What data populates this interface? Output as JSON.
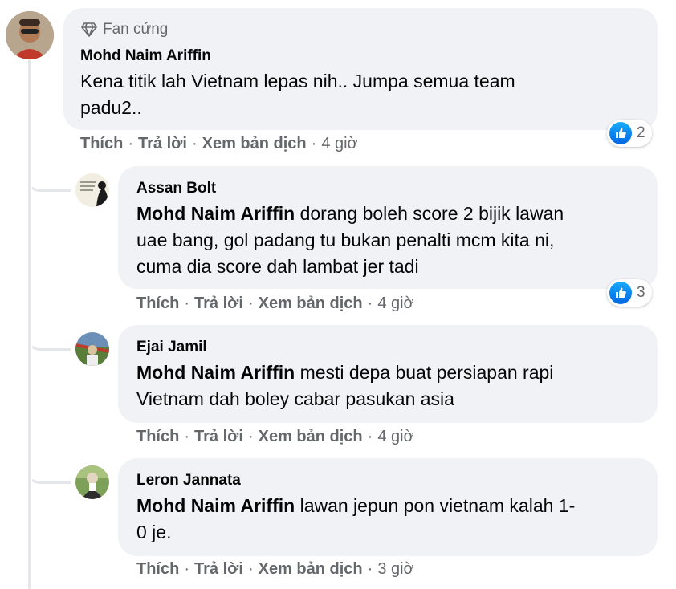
{
  "comments": [
    {
      "badge": "Fan cứng",
      "author": "Mohd Naim Ariffin",
      "lines": [
        "Kena titik lah Vietnam lepas nih.. Jumpa semua team",
        "padu2.."
      ],
      "like": "Thích",
      "reply": "Trả lời",
      "translate": "Xem bản dịch",
      "time": "4 giờ",
      "reactions": "2"
    },
    {
      "author": "Assan Bolt",
      "tag": "Mohd Naim Ariffin",
      "line1": " dorang boleh score 2 bijik lawan",
      "line2": "uae bang, gol padang tu bukan penalti mcm kita ni,",
      "line3": "cuma dia score dah lambat jer tadi",
      "like": "Thích",
      "reply": "Trả lời",
      "translate": "Xem bản dịch",
      "time": "4 giờ",
      "reactions": "3"
    },
    {
      "author": "Ejai Jamil",
      "tag": "Mohd Naim Ariffin",
      "line1": " mesti depa buat persiapan rapi",
      "line2": "Vietnam dah boley cabar pasukan asia",
      "like": "Thích",
      "reply": "Trả lời",
      "translate": "Xem bản dịch",
      "time": "4 giờ"
    },
    {
      "author": "Leron Jannata",
      "tag": "Mohd Naim Ariffin",
      "line1": " lawan jepun pon vietnam kalah 1-",
      "line2": "0 je.",
      "like": "Thích",
      "reply": "Trả lời",
      "translate": "Xem bản dịch",
      "time": "3 giờ"
    }
  ],
  "colors": {
    "bubble": "#f0f2f5",
    "secondary": "#65676b",
    "like_blue": "#0866ff"
  }
}
